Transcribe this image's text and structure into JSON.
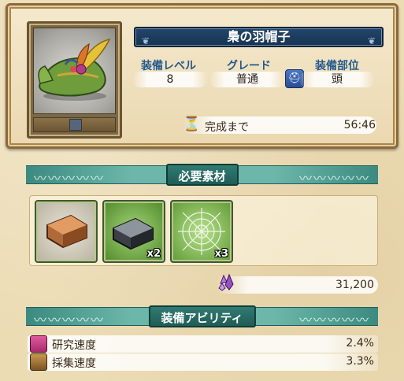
{
  "item": {
    "name": "梟の羽帽子",
    "icon": "green-feathered-hat-icon"
  },
  "stats": {
    "level_label": "装備レベル",
    "level_value": "8",
    "grade_label": "グレード",
    "grade_value": "普通",
    "part_label": "装備部位",
    "part_value": "頭",
    "part_icon": "helmet-icon"
  },
  "completion": {
    "label": "完成まで",
    "time": "56:46",
    "icon": "hourglass-icon"
  },
  "materials": {
    "title": "必要素材",
    "items": [
      {
        "icon": "bronze-ingot-icon",
        "count": ""
      },
      {
        "icon": "iron-ingot-icon",
        "count": "x2"
      },
      {
        "icon": "spider-web-icon",
        "count": "x3"
      }
    ],
    "cost_icon": "purple-gem-icon",
    "cost": "31,200"
  },
  "abilities": {
    "title": "装備アビリティ",
    "items": [
      {
        "icon": "research-book-icon",
        "label": "研究速度",
        "value": "2.4%"
      },
      {
        "icon": "gather-chest-icon",
        "label": "採集速度",
        "value": "3.3%"
      }
    ]
  },
  "colors": {
    "banner_blue": "#1c3c5e",
    "section_teal": "#2f7a72",
    "label_blue": "#245a8c"
  }
}
